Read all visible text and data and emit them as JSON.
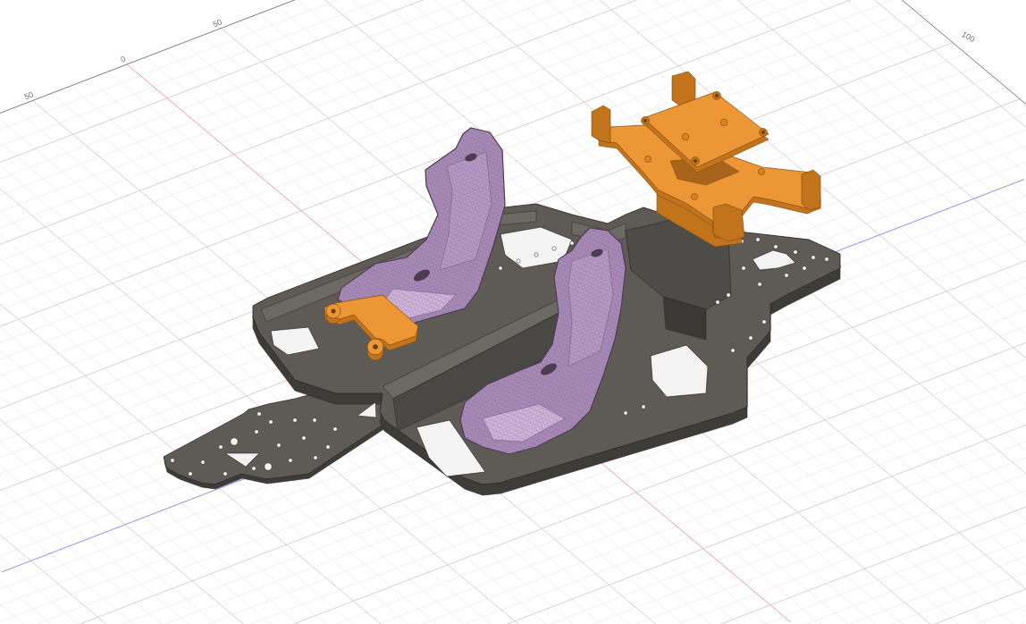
{
  "viewport": {
    "back_edge_labels": [
      "50",
      "0",
      "50"
    ],
    "side_edge_labels": [
      "100"
    ]
  }
}
